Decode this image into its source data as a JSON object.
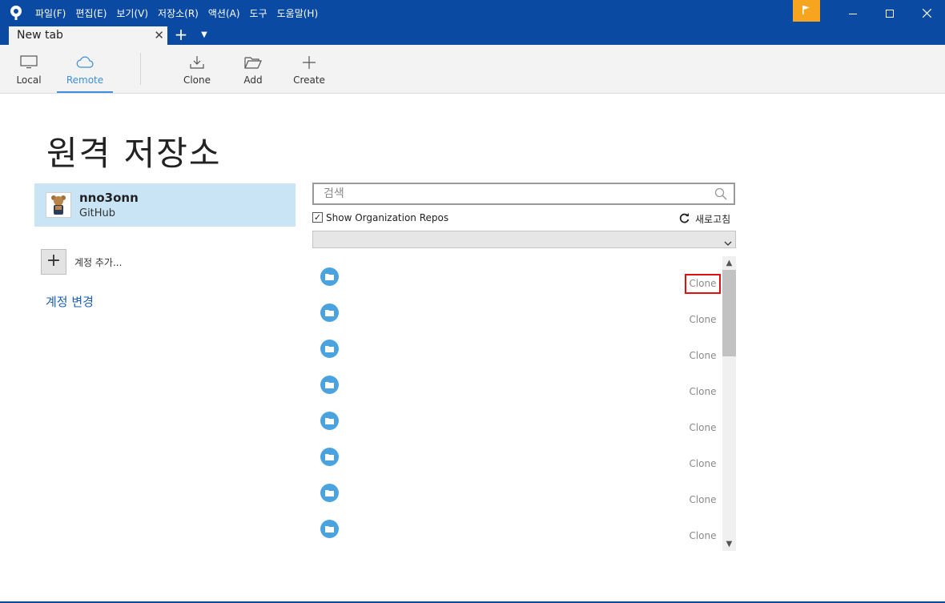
{
  "menu": {
    "file": "파일(F)",
    "edit": "편집(E)",
    "view": "보기(V)",
    "repository": "저장소(R)",
    "actions": "액션(A)",
    "tools": "도구",
    "help": "도움말(H)"
  },
  "tab": {
    "title": "New tab",
    "close": "✕",
    "add": "+"
  },
  "toolbar": {
    "local": "Local",
    "remote": "Remote",
    "clone": "Clone",
    "add": "Add",
    "create": "Create"
  },
  "page": {
    "title": "원격 저장소"
  },
  "account": {
    "name": "nno3onn",
    "host": "GitHub",
    "add_label": "계정 추가...",
    "change_label": "계정 변경"
  },
  "search": {
    "placeholder": "검색",
    "value": ""
  },
  "org_toggle": {
    "label": "Show Organization Repos",
    "checked": true
  },
  "refresh_label": "새로고침",
  "filter": {
    "selected": ""
  },
  "repos": [
    {
      "clone_label": "Clone"
    },
    {
      "clone_label": "Clone"
    },
    {
      "clone_label": "Clone"
    },
    {
      "clone_label": "Clone"
    },
    {
      "clone_label": "Clone"
    },
    {
      "clone_label": "Clone"
    },
    {
      "clone_label": "Clone"
    },
    {
      "clone_label": "Clone"
    }
  ],
  "colors": {
    "titlebar": "#0a4aa3",
    "accent": "#3c8fd8",
    "flag": "#f7a51e",
    "selected_account": "#c9e4f5",
    "focus_outline": "#e01010"
  }
}
